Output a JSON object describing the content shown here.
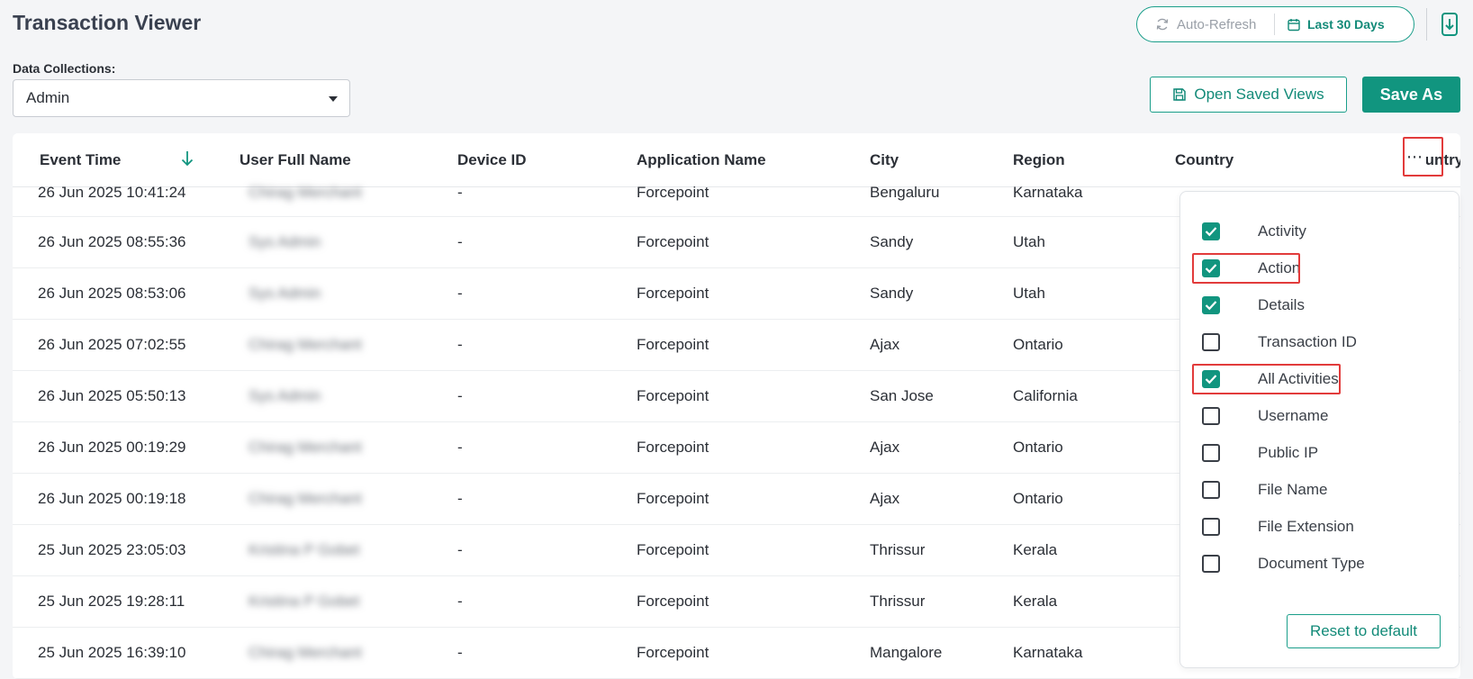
{
  "header": {
    "title": "Transaction Viewer",
    "auto_refresh": "Auto-Refresh",
    "date_range": "Last 30 Days"
  },
  "data_collections": {
    "label": "Data Collections:",
    "selected": "Admin"
  },
  "toolbar": {
    "open_saved_views": "Open Saved Views",
    "save_as": "Save As"
  },
  "table": {
    "columns": [
      "Event Time",
      "User Full Name",
      "Device ID",
      "Application Name",
      "City",
      "Region",
      "Country"
    ],
    "rows": [
      {
        "time": "26 Jun 2025 10:41:24",
        "user": "Chirag Merchant",
        "device": "-",
        "app": "Forcepoint",
        "city": "Bengaluru",
        "region": "Karnataka"
      },
      {
        "time": "26 Jun 2025 08:55:36",
        "user": "Sys Admin",
        "device": "-",
        "app": "Forcepoint",
        "city": "Sandy",
        "region": "Utah"
      },
      {
        "time": "26 Jun 2025 08:53:06",
        "user": "Sys Admin",
        "device": "-",
        "app": "Forcepoint",
        "city": "Sandy",
        "region": "Utah"
      },
      {
        "time": "26 Jun 2025 07:02:55",
        "user": "Chirag Merchant",
        "device": "-",
        "app": "Forcepoint",
        "city": "Ajax",
        "region": "Ontario"
      },
      {
        "time": "26 Jun 2025 05:50:13",
        "user": "Sys Admin",
        "device": "-",
        "app": "Forcepoint",
        "city": "San Jose",
        "region": "California"
      },
      {
        "time": "26 Jun 2025 00:19:29",
        "user": "Chirag Merchant",
        "device": "-",
        "app": "Forcepoint",
        "city": "Ajax",
        "region": "Ontario"
      },
      {
        "time": "26 Jun 2025 00:19:18",
        "user": "Chirag Merchant",
        "device": "-",
        "app": "Forcepoint",
        "city": "Ajax",
        "region": "Ontario"
      },
      {
        "time": "25 Jun 2025 23:05:03",
        "user": "Kristina P Gobet",
        "device": "-",
        "app": "Forcepoint",
        "city": "Thrissur",
        "region": "Kerala"
      },
      {
        "time": "25 Jun 2025 19:28:11",
        "user": "Kristina P Gobet",
        "device": "-",
        "app": "Forcepoint",
        "city": "Thrissur",
        "region": "Kerala"
      },
      {
        "time": "25 Jun 2025 16:39:10",
        "user": "Chirag Merchant",
        "device": "-",
        "app": "Forcepoint",
        "city": "Mangalore",
        "region": "Karnataka"
      }
    ]
  },
  "column_menu": {
    "more_glyph": "⋯",
    "options": [
      {
        "label": "Activity",
        "checked": true
      },
      {
        "label": "Action",
        "checked": true
      },
      {
        "label": "Details",
        "checked": true
      },
      {
        "label": "Transaction ID",
        "checked": false
      },
      {
        "label": "All Activities",
        "checked": true
      },
      {
        "label": "Username",
        "checked": false
      },
      {
        "label": "Public IP",
        "checked": false
      },
      {
        "label": "File Name",
        "checked": false
      },
      {
        "label": "File Extension",
        "checked": false
      },
      {
        "label": "Document Type",
        "checked": false
      }
    ],
    "reset_label": "Reset to default"
  },
  "colors": {
    "accent": "#11957f",
    "highlight": "#e23b3b"
  },
  "icons": {
    "refresh": "refresh-icon",
    "calendar": "calendar-icon",
    "export": "export-download-icon",
    "save": "floppy-disk-icon",
    "sort": "arrow-down-icon",
    "caret": "caret-down-icon",
    "more": "more-horizontal-icon"
  }
}
